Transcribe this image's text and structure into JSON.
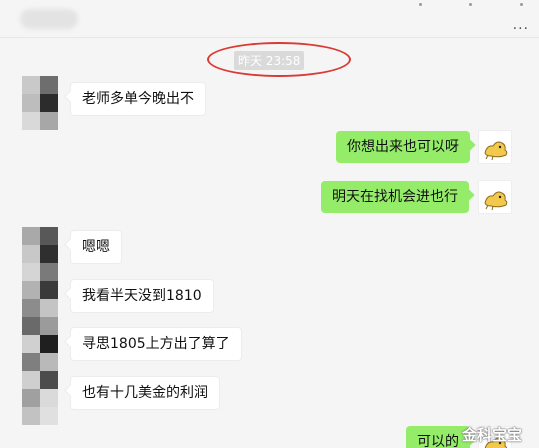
{
  "header": {
    "more_icon": "more-dots-icon",
    "more_label": "···"
  },
  "timestamp": "昨天 23:58",
  "messages": [
    {
      "side": "left",
      "text": "老师多单今晚出不"
    },
    {
      "side": "right",
      "text": "你想出来也可以呀"
    },
    {
      "side": "right",
      "text": "明天在找机会进也行"
    },
    {
      "side": "left",
      "text": "嗯嗯"
    },
    {
      "side": "left",
      "text": "我看半天没到1810"
    },
    {
      "side": "left",
      "text": "寻思1805上方出了算了"
    },
    {
      "side": "left",
      "text": "也有十几美金的利润"
    },
    {
      "side": "right",
      "text": "可以的"
    }
  ],
  "watermark": "金科宝宝",
  "colors": {
    "accent": "#95ec69",
    "annotation": "#d93a34",
    "background": "#f5f5f5"
  }
}
